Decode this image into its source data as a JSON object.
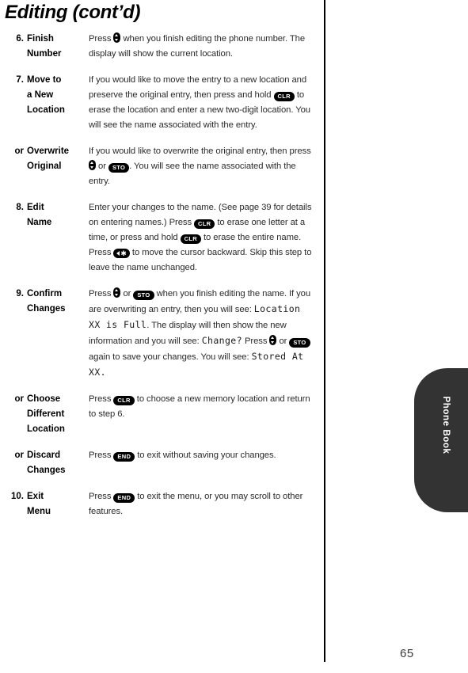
{
  "header": {
    "chapter_title": "Editing (cont’d)"
  },
  "margin": {
    "chapter_tab_label": "Phone Book",
    "tab_color": "#333333"
  },
  "footer": {
    "page_number": "65"
  },
  "keys": {
    "clr": "CLR",
    "sto": "STO",
    "end": "END",
    "scroll": "scroll-key-up-down",
    "back_star": "left-arrow-star-key"
  },
  "lcd_messages": {
    "location_full": "Location XX is Full",
    "change_prompt": "Change?",
    "stored_at": "Stored At XX."
  },
  "steps": [
    {
      "num": "6.",
      "name_lines": [
        "Finish",
        "Number"
      ],
      "body_segments": [
        {
          "type": "text",
          "value": "Press "
        },
        {
          "type": "key-scroll",
          "value": "scroll-key-up-down"
        },
        {
          "type": "text",
          "value": " when you finish editing the phone number. The display will show the current location."
        }
      ]
    },
    {
      "num": "7.",
      "name_lines": [
        "Move to",
        "a New",
        "Location"
      ],
      "body_segments": [
        {
          "type": "text",
          "value": "If you would like to move the entry to a new location and preserve the original entry, then press and hold "
        },
        {
          "type": "key",
          "value": "CLR"
        },
        {
          "type": "text",
          "value": " to erase the location and enter a new two-digit location. You will see the name associated with the entry."
        }
      ]
    },
    {
      "num": "or",
      "name_lines": [
        "Overwrite",
        "Original"
      ],
      "body_segments": [
        {
          "type": "text",
          "value": "If you would like to overwrite the original entry, then press "
        },
        {
          "type": "key-scroll",
          "value": "scroll-key-up-down"
        },
        {
          "type": "text",
          "value": " or "
        },
        {
          "type": "key",
          "value": "STO"
        },
        {
          "type": "text",
          "value": ". You will see the name associated with the entry."
        }
      ]
    },
    {
      "num": "8.",
      "name_lines": [
        "Edit",
        "Name"
      ],
      "body_segments": [
        {
          "type": "text",
          "value": "Enter your changes to the name. (See page 39 for details on entering names.) Press "
        },
        {
          "type": "key",
          "value": "CLR"
        },
        {
          "type": "text",
          "value": " to erase one letter at a time, or press and hold "
        },
        {
          "type": "key",
          "value": "CLR"
        },
        {
          "type": "text",
          "value": " to erase the entire name. Press "
        },
        {
          "type": "key-back",
          "value": "left-arrow-star-key"
        },
        {
          "type": "text",
          "value": " to move the cursor backward. Skip this step to leave the name unchanged."
        }
      ]
    },
    {
      "num": "9.",
      "name_lines": [
        "Confirm",
        "Changes"
      ],
      "body_segments": [
        {
          "type": "text",
          "value": "Press "
        },
        {
          "type": "key-scroll",
          "value": "scroll-key-up-down"
        },
        {
          "type": "text",
          "value": " or "
        },
        {
          "type": "key",
          "value": "STO"
        },
        {
          "type": "text",
          "value": " when you finish editing the name. If you are overwriting an entry, then you will see: "
        },
        {
          "type": "lcd",
          "value": "Location XX is Full"
        },
        {
          "type": "text",
          "value": ". The display will then show the new information and you will see: "
        },
        {
          "type": "lcd",
          "value": "Change?"
        },
        {
          "type": "text",
          "value": " Press "
        },
        {
          "type": "key-scroll",
          "value": "scroll-key-up-down"
        },
        {
          "type": "text",
          "value": " or "
        },
        {
          "type": "key",
          "value": "STO"
        },
        {
          "type": "text",
          "value": " again to save your changes. You will see: "
        },
        {
          "type": "lcd",
          "value": "Stored At XX."
        }
      ]
    },
    {
      "num": "or",
      "name_lines": [
        "Choose",
        "Different",
        "Location"
      ],
      "body_segments": [
        {
          "type": "text",
          "value": "Press "
        },
        {
          "type": "key",
          "value": "CLR"
        },
        {
          "type": "text",
          "value": " to choose a new memory location and return to step 6."
        }
      ]
    },
    {
      "num": "or",
      "name_lines": [
        "Discard",
        "Changes"
      ],
      "body_segments": [
        {
          "type": "text",
          "value": "Press "
        },
        {
          "type": "key",
          "value": "END"
        },
        {
          "type": "text",
          "value": " to exit without saving your changes."
        }
      ]
    },
    {
      "num": "10.",
      "name_lines": [
        "Exit",
        "Menu"
      ],
      "body_segments": [
        {
          "type": "text",
          "value": "Press "
        },
        {
          "type": "key",
          "value": "END"
        },
        {
          "type": "text",
          "value": " to exit the menu, or you may scroll to other features."
        }
      ]
    }
  ]
}
